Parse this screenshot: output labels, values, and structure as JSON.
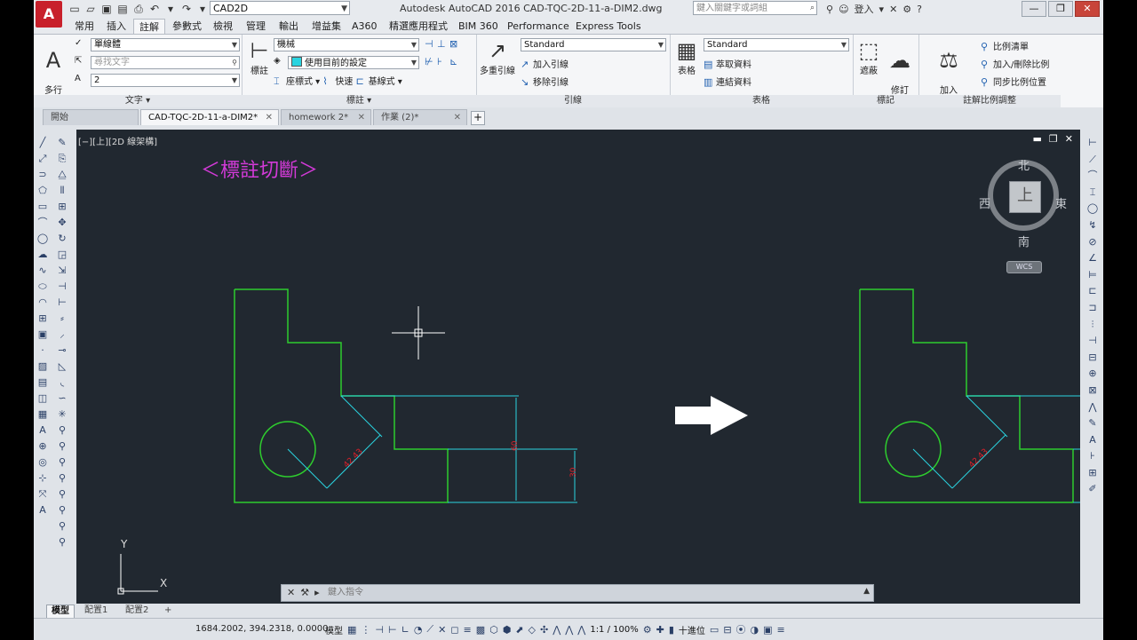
{
  "app": {
    "title": "Autodesk AutoCAD 2016    CAD-TQC-2D-11-a-DIM2.dwg",
    "app_button_glyph": "A",
    "workspace": "CAD2D",
    "search_placeholder": "鍵入關鍵字或詞組",
    "login": "登入",
    "window_controls": [
      "—",
      "❐",
      "✕"
    ]
  },
  "ribbon_tabs": [
    "常用",
    "插入",
    "註解",
    "參數式",
    "檢視",
    "管理",
    "輸出",
    "增益集",
    "A360",
    "精選應用程式",
    "BIM 360",
    "Performance",
    "Express Tools"
  ],
  "active_ribbon_tab": "註解",
  "panels": {
    "text": {
      "title": "文字 ▾",
      "big_label": "多行\n文字",
      "font_style": "單線體",
      "find_placeholder": "尋找文字",
      "height": "2"
    },
    "dims": {
      "title": "標註 ▾",
      "big_label": "標註",
      "dim_style": "機械",
      "layer_value": "使用目前的設定",
      "row3": [
        "座標式 ▾",
        "快速",
        "基線式 ▾"
      ]
    },
    "leaders": {
      "title": "引線",
      "big_label": "多重引線",
      "style": "Standard",
      "add": "加入引線",
      "remove": "移除引線"
    },
    "tables": {
      "title": "表格",
      "big_label": "表格",
      "style": "Standard",
      "extract": "萃取資料",
      "link": "連結資料"
    },
    "markup": {
      "title": "標記",
      "wipeout": "遮蔽",
      "revcloud": "修訂\n雲形"
    },
    "scaling": {
      "title": "註解比例調整",
      "add_label": "加入\n目前的比例",
      "list": "比例清單",
      "add_remove": "加入/刪除比例",
      "sync": "同步比例位置"
    }
  },
  "doc_tabs": [
    {
      "label": "開始",
      "active": false,
      "closable": false
    },
    {
      "label": "CAD-TQC-2D-11-a-DIM2*",
      "active": true,
      "closable": true
    },
    {
      "label": "homework 2*",
      "active": false,
      "closable": true
    },
    {
      "label": "作業 (2)*",
      "active": false,
      "closable": true
    }
  ],
  "viewport": {
    "label": "[−][上][2D 線架構]",
    "heading": "＜標註切斷＞",
    "viewcube": {
      "face": "上",
      "north": "北",
      "south": "南",
      "east": "東",
      "west": "西",
      "wcs": "WCS"
    },
    "ucs_x": "X",
    "ucs_y": "Y",
    "dims": {
      "aligned": "42.43",
      "vert_big": "60",
      "vert_small": "30",
      "aligned_right": "42.43"
    },
    "colors": {
      "geometry": "#2ecc2e",
      "dimension": "#2ad4e0",
      "dimtext": "#e0202a",
      "heading": "#d33ad8",
      "background": "#212830"
    }
  },
  "command_line": {
    "placeholder": "鍵入指令"
  },
  "layout_tabs": [
    {
      "label": "模型",
      "active": true
    },
    {
      "label": "配置1",
      "active": false
    },
    {
      "label": "配置2",
      "active": false
    }
  ],
  "status": {
    "coords": "1684.2002, 394.2318, 0.0000",
    "model": "模型",
    "scale": "1:1 / 100%",
    "units": "十進位"
  }
}
